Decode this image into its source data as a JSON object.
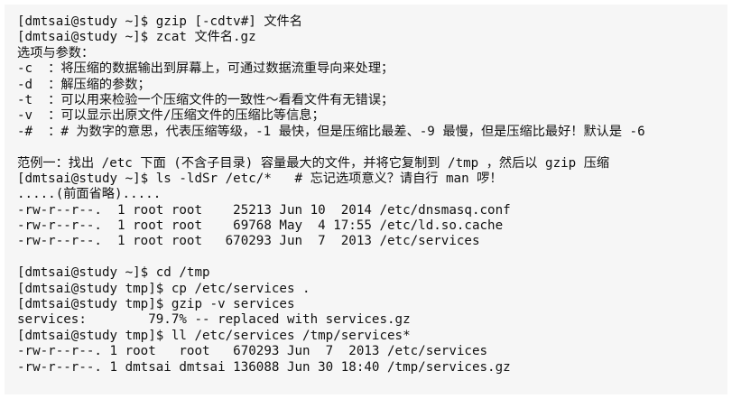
{
  "lines": [
    "[dmtsai@study ~]$ gzip [-cdtv#] 文件名",
    "[dmtsai@study ~]$ zcat 文件名.gz",
    "选项与参数：",
    "-c  ：将压缩的数据输出到屏幕上，可通过数据流重导向来处理；",
    "-d  ：解压缩的参数；",
    "-t  ：可以用来检验一个压缩文件的一致性～看看文件有无错误；",
    "-v  ：可以显示出原文件/压缩文件的压缩比等信息；",
    "-#  ：# 为数字的意思，代表压缩等级，-1 最快，但是压缩比最差、-9 最慢，但是压缩比最好！默认是 -6",
    "",
    "范例一：找出 /etc 下面 (不含子目录) 容量最大的文件，并将它复制到 /tmp ，然后以 gzip 压缩",
    "[dmtsai@study ~]$ ls -ldSr /etc/*   # 忘记选项意义？请自行 man 啰！",
    ".....(前面省略).....",
    "-rw-r--r--.  1 root root    25213 Jun 10  2014 /etc/dnsmasq.conf",
    "-rw-r--r--.  1 root root    69768 May  4 17:55 /etc/ld.so.cache",
    "-rw-r--r--.  1 root root   670293 Jun  7  2013 /etc/services",
    "",
    "[dmtsai@study ~]$ cd /tmp",
    "[dmtsai@study tmp]$ cp /etc/services .",
    "[dmtsai@study tmp]$ gzip -v services",
    "services:        79.7% -- replaced with services.gz",
    "[dmtsai@study tmp]$ ll /etc/services /tmp/services*",
    "-rw-r--r--. 1 root   root   670293 Jun  7  2013 /etc/services",
    "-rw-r--r--. 1 dmtsai dmtsai 136088 Jun 30 18:40 /tmp/services.gz"
  ]
}
